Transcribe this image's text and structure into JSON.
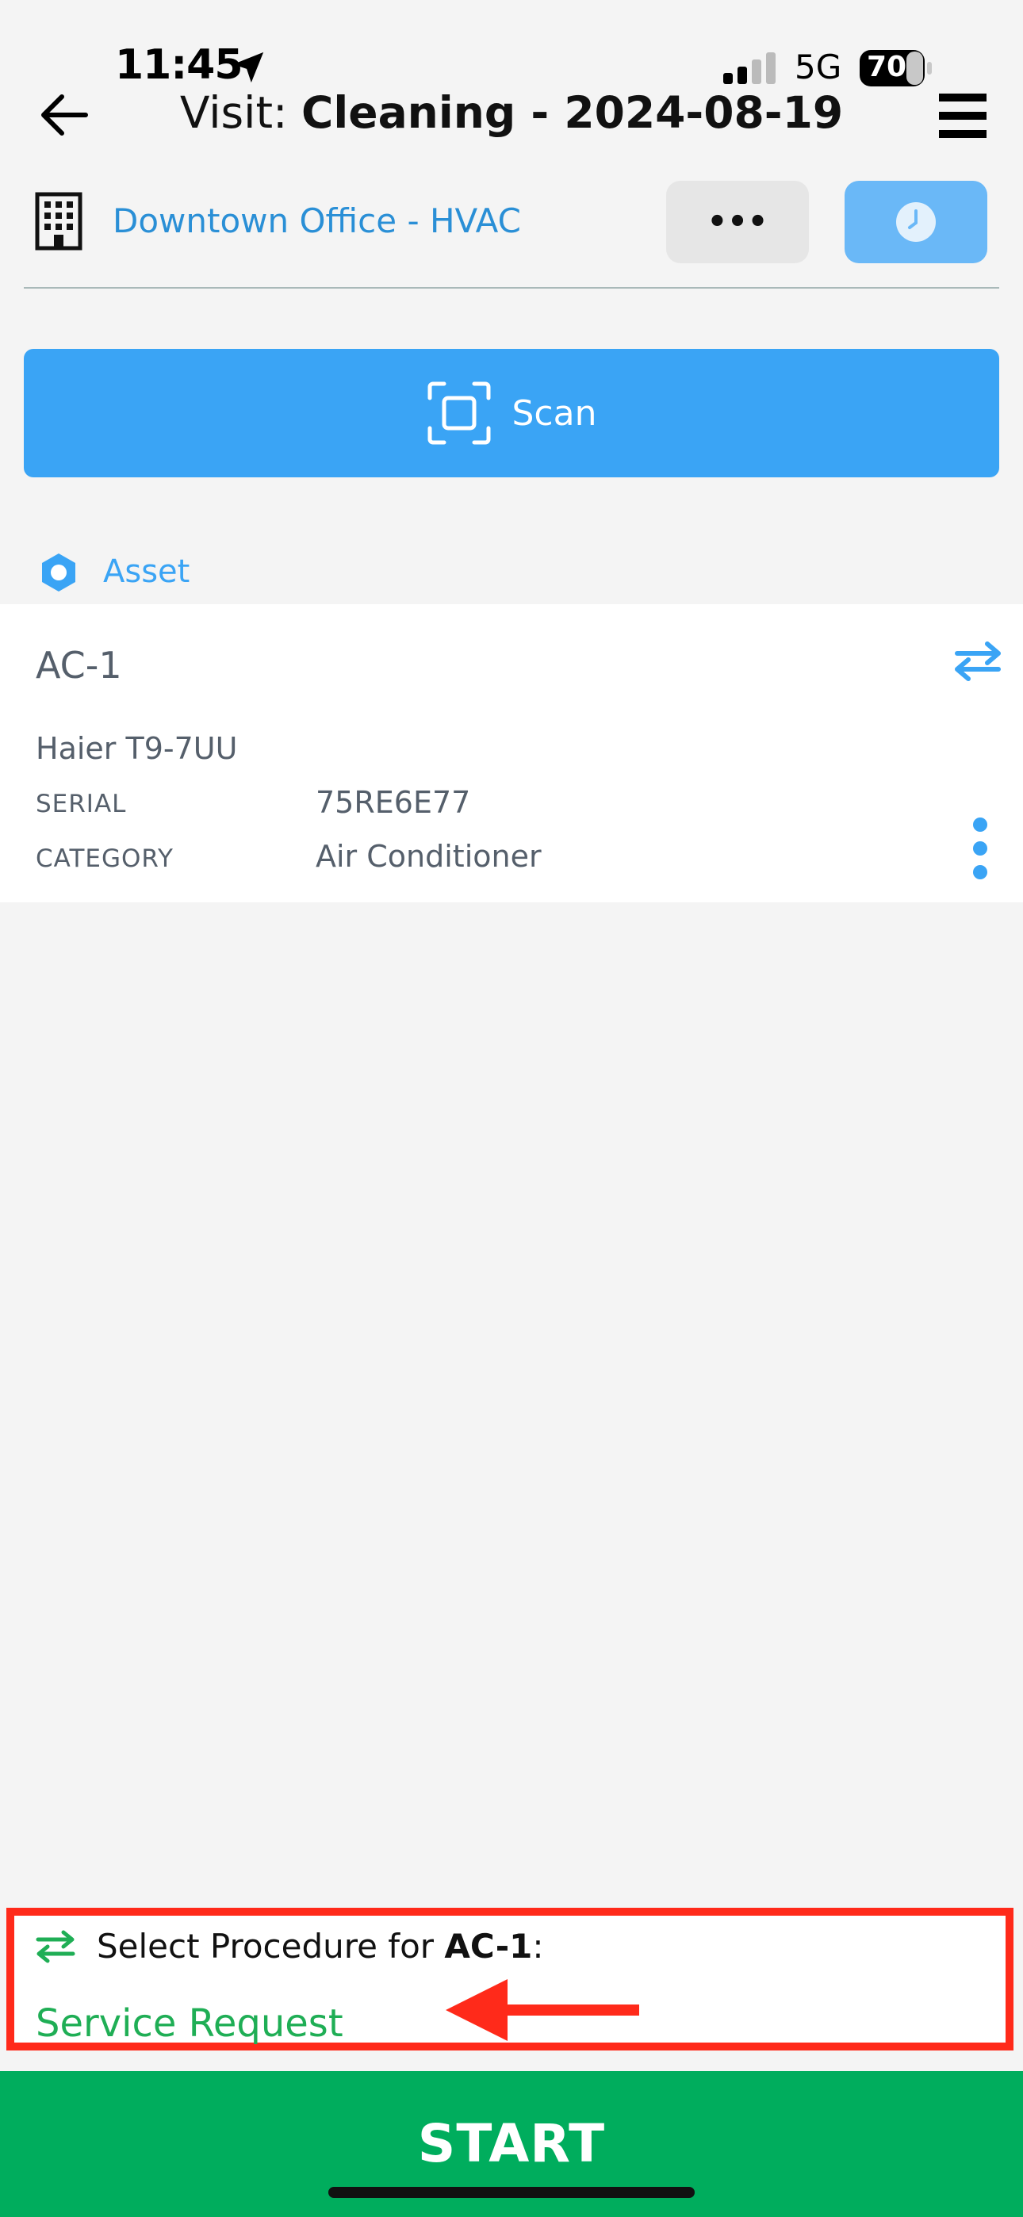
{
  "status_bar": {
    "time": "11:45",
    "network": "5G",
    "battery": "70"
  },
  "header": {
    "title_prefix": "Visit:",
    "title_main": "Cleaning - 2024-08-19"
  },
  "site": {
    "name": "Downtown Office - HVAC",
    "more_label": "•••"
  },
  "scan": {
    "label": "Scan"
  },
  "asset_section": {
    "label": "Asset"
  },
  "asset": {
    "name": "AC-1",
    "model": "Haier T9-7UU",
    "fields": [
      {
        "key": "SERIAL",
        "value": "75RE6E77"
      },
      {
        "key": "CATEGORY",
        "value": "Air Conditioner"
      }
    ]
  },
  "procedure": {
    "prompt": "Select Procedure for",
    "asset_ref": "AC-1",
    "colon": ":",
    "selected": "Service Request"
  },
  "start": {
    "label": "START"
  },
  "colors": {
    "accent": "#3aa4f5",
    "link": "#2a8fd6",
    "success": "#00ad5d",
    "highlight": "#ff2a1a"
  }
}
